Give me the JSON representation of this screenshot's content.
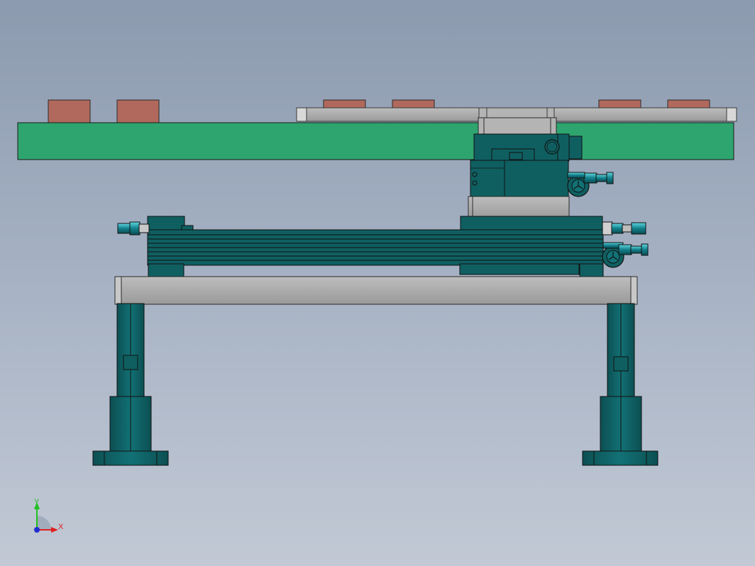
{
  "viewport": {
    "background_top": "#8c9aaf",
    "background_bottom": "#c2c9d5"
  },
  "model": {
    "colors": {
      "plate_green": "#2ea56f",
      "pad_brick": "#b0695c",
      "rail_gray": "#a6a6a6",
      "actuator_teal": "#0f5f61",
      "fitting_cyan": "#1c8a96",
      "edge": "#1a1a1a"
    }
  },
  "triad": {
    "x_label": "X",
    "y_label": "Y",
    "x_color": "#e02020",
    "y_color": "#20c020",
    "origin_color": "#2030d0"
  }
}
